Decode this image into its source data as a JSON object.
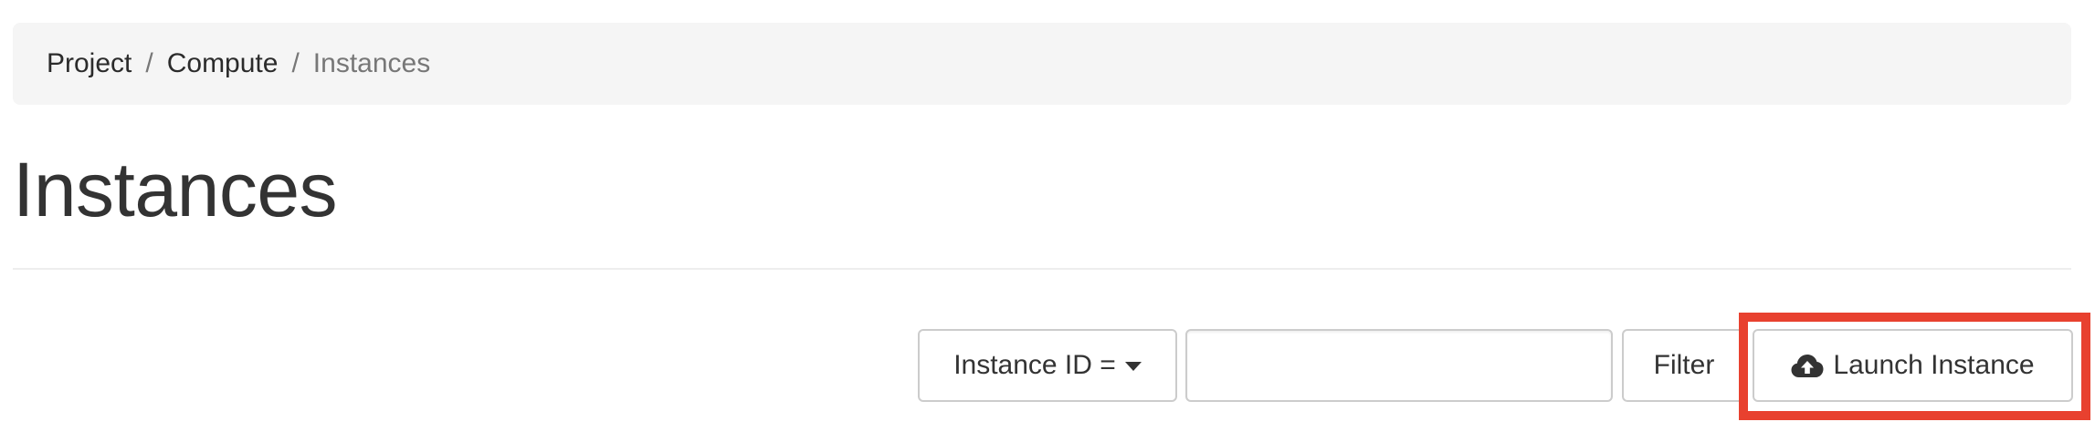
{
  "breadcrumb": {
    "items": [
      {
        "label": "Project"
      },
      {
        "label": "Compute"
      }
    ],
    "separator": "/",
    "active": "Instances"
  },
  "page": {
    "title": "Instances"
  },
  "toolbar": {
    "filter_field_label": "Instance ID =",
    "filter_input_value": "",
    "filter_button_label": "Filter",
    "launch_button_label": "Launch Instance",
    "launch_button_icon": "cloud-upload-icon",
    "highlight_color": "#e8412f"
  }
}
